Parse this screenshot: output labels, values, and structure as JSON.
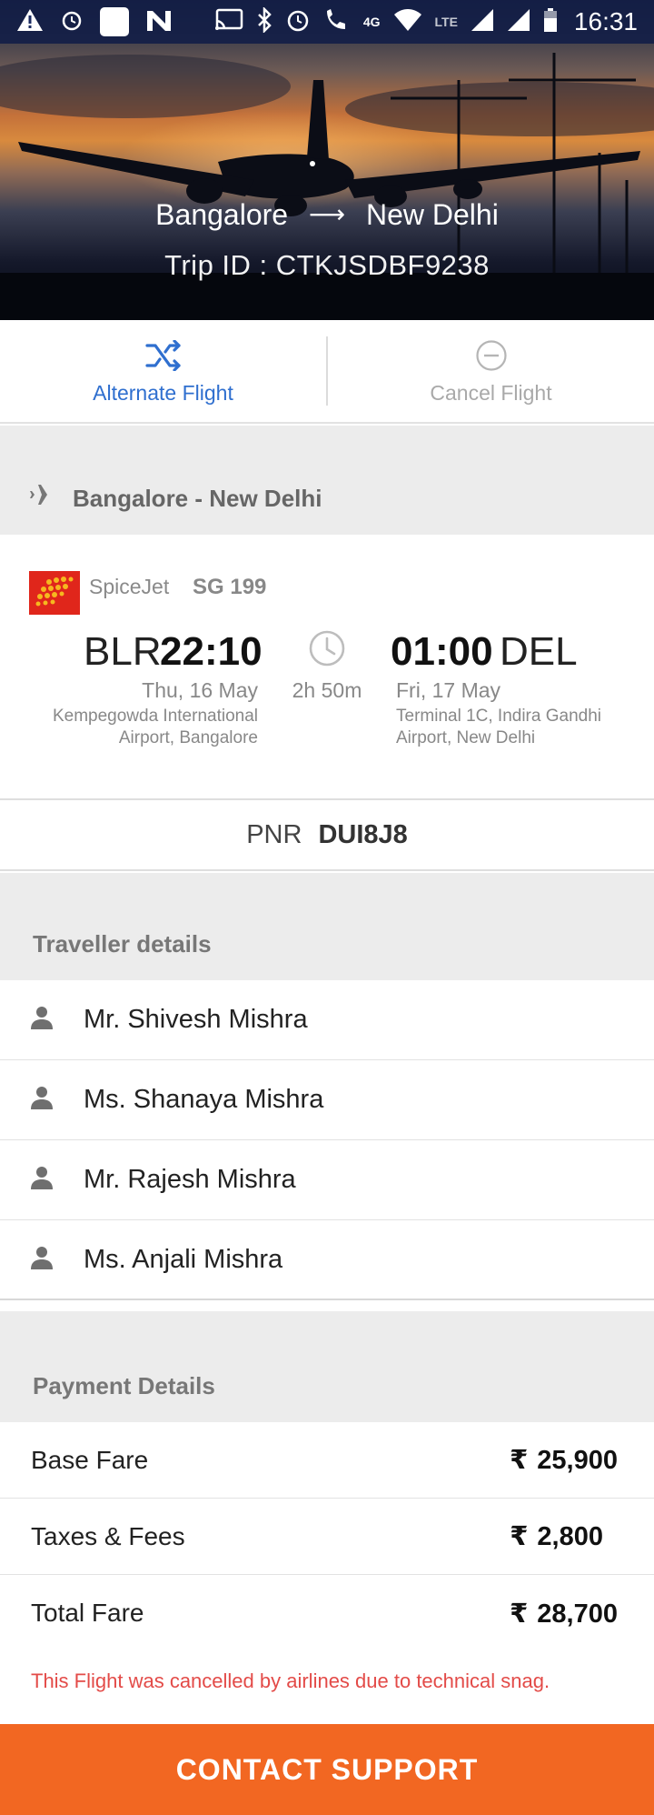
{
  "status_bar": {
    "time": "16:31",
    "network_label": "4G",
    "lte_label": "LTE"
  },
  "header": {
    "origin": "Bangalore",
    "destination": "New Delhi",
    "trip_id": "Trip ID : CTKJSDBF9238"
  },
  "actions": {
    "alternate_label": "Alternate Flight",
    "cancel_label": "Cancel Flight"
  },
  "segment": {
    "title": "Bangalore - New Delhi"
  },
  "flight": {
    "airline": "SpiceJet",
    "flight_number": "SG 199",
    "departure": {
      "code": "BLR",
      "time": "22:10",
      "date": "Thu, 16 May",
      "airport": "Kempegowda International Airport, Bangalore"
    },
    "duration": "2h 50m",
    "arrival": {
      "code": "DEL",
      "time": "01:00",
      "date": "Fri, 17 May",
      "airport": "Terminal 1C, Indira Gandhi Airport, New Delhi"
    }
  },
  "pnr": {
    "label": "PNR",
    "value": "DUI8J8"
  },
  "travellers": {
    "title": "Traveller details",
    "items": [
      {
        "name": "Mr. Shivesh Mishra"
      },
      {
        "name": "Ms. Shanaya Mishra"
      },
      {
        "name": "Mr. Rajesh Mishra"
      },
      {
        "name": "Ms. Anjali Mishra"
      }
    ]
  },
  "payment": {
    "title": "Payment Details",
    "currency_symbol": "₹",
    "items": [
      {
        "label": "Base Fare",
        "amount": "25,900"
      },
      {
        "label": "Taxes & Fees",
        "amount": "2,800"
      },
      {
        "label": "Total Fare",
        "amount": "28,700"
      }
    ]
  },
  "notice": "This Flight was cancelled by airlines due to technical snag.",
  "contact_button": "CONTACT SUPPORT",
  "colors": {
    "accent_blue": "#2f6fcf",
    "cta_orange": "#f26722",
    "error_red": "#e34b48",
    "section_gray": "#ececec"
  }
}
